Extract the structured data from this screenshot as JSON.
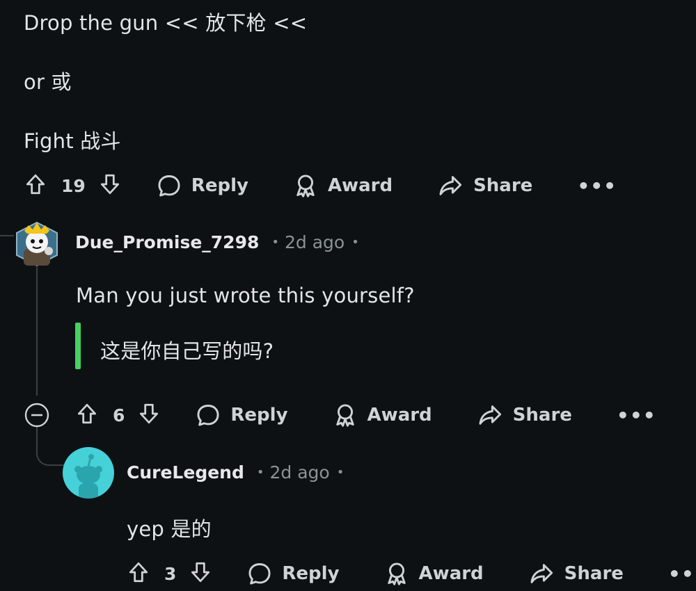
{
  "parent_comment": {
    "lines": [
      "Drop the gun << 放下枪 <<",
      "or 或",
      "Fight 战斗"
    ],
    "votes": "19",
    "reply_label": "Reply",
    "award_label": "Award",
    "share_label": "Share",
    "more_label": "•••"
  },
  "comment1": {
    "username": "Due_Promise_7298",
    "timestamp": "2d ago",
    "body": "Man you just wrote this yourself?",
    "quote": "这是你自己写的吗?",
    "votes": "6",
    "reply_label": "Reply",
    "award_label": "Award",
    "share_label": "Share",
    "more_label": "•••",
    "collapse_icon": "minus-circle-icon"
  },
  "comment2": {
    "username": "CureLegend",
    "timestamp": "2d ago",
    "body": "yep 是的",
    "votes": "3",
    "reply_label": "Reply",
    "award_label": "Award",
    "share_label": "Share",
    "more_label": "•••"
  },
  "colors": {
    "background": "#0e1113",
    "quote_bar": "#46d160",
    "avatar2": "#46d1d8"
  }
}
